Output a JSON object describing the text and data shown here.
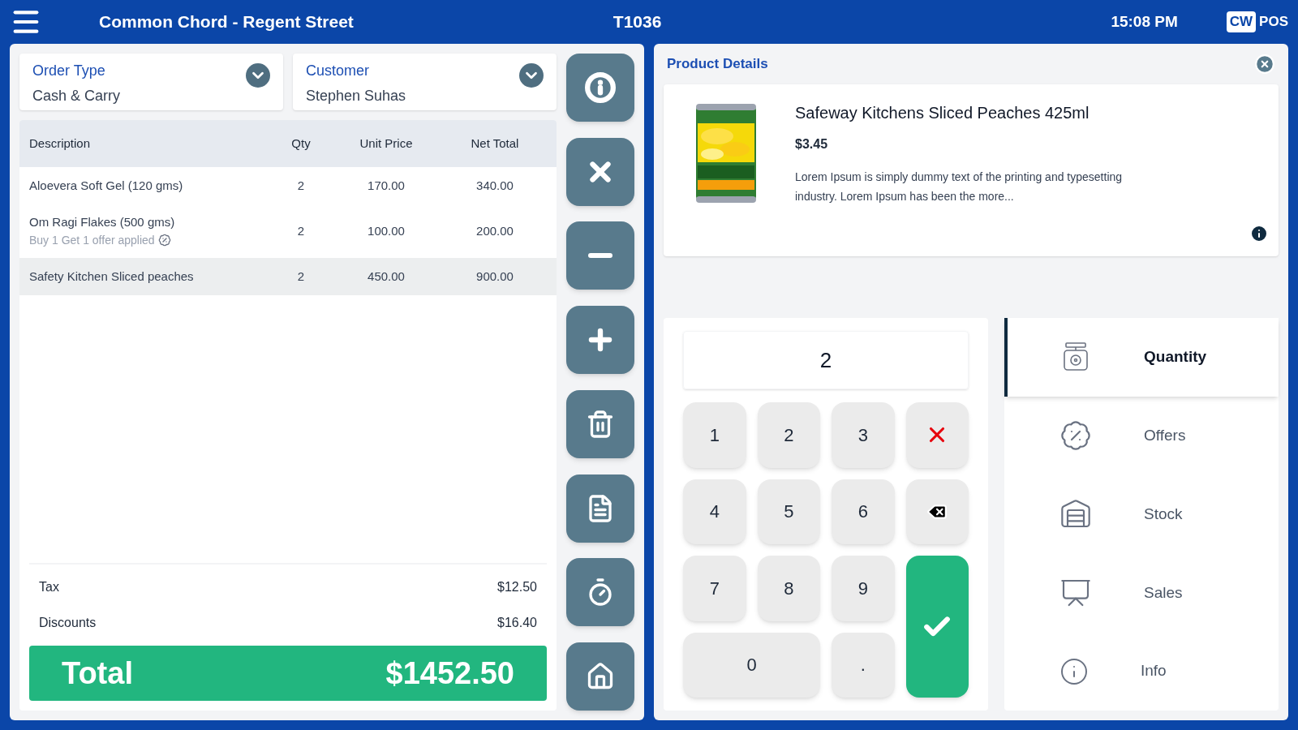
{
  "header": {
    "title": "Common Chord - Regent Street",
    "terminal": "T1036",
    "time": "15:08 PM",
    "logo": {
      "mark": "CW",
      "text": "POS"
    }
  },
  "order_type": {
    "label": "Order Type",
    "value": "Cash & Carry"
  },
  "customer": {
    "label": "Customer",
    "value": "Stephen Suhas"
  },
  "table": {
    "columns": [
      "Description",
      "Qty",
      "Unit Price",
      "Net Total"
    ],
    "rows": [
      {
        "description": "Aloevera Soft Gel (120 gms)",
        "qty": "2",
        "unit_price": "170.00",
        "net_total": "340.00",
        "selected": false
      },
      {
        "description": "Om Ragi Flakes (500 gms)",
        "note": "Buy 1 Get 1 offer applied",
        "qty": "2",
        "unit_price": "100.00",
        "net_total": "200.00",
        "selected": false
      },
      {
        "description": "Safety Kitchen Sliced peaches",
        "qty": "2",
        "unit_price": "450.00",
        "net_total": "900.00",
        "selected": true
      }
    ]
  },
  "summary": [
    {
      "label": "Tax",
      "value": "$12.50"
    },
    {
      "label": "Discounts",
      "value": "$16.40"
    }
  ],
  "total": {
    "label": "Total",
    "value": "$1452.50"
  },
  "actions": [
    {
      "kind": "info"
    },
    {
      "kind": "cancel"
    },
    {
      "kind": "minus"
    },
    {
      "kind": "plus"
    },
    {
      "kind": "delete"
    },
    {
      "kind": "note"
    },
    {
      "kind": "timer"
    },
    {
      "kind": "home"
    }
  ],
  "product": {
    "heading": "Product Details",
    "name": "Safeway Kitchens Sliced Peaches 425ml",
    "price": "$3.45",
    "description": "Lorem Ipsum is simply dummy text of the printing and typesetting industry. Lorem Ipsum has been the more..."
  },
  "keypad": {
    "display": "2",
    "keys": [
      {
        "kind": "digit",
        "label": "1"
      },
      {
        "kind": "digit",
        "label": "2"
      },
      {
        "kind": "digit",
        "label": "3"
      },
      {
        "kind": "clear"
      },
      {
        "kind": "digit",
        "label": "4"
      },
      {
        "kind": "digit",
        "label": "5"
      },
      {
        "kind": "digit",
        "label": "6"
      },
      {
        "kind": "backspace"
      },
      {
        "kind": "digit",
        "label": "7"
      },
      {
        "kind": "digit",
        "label": "8"
      },
      {
        "kind": "digit",
        "label": "9"
      },
      {
        "kind": "enter"
      },
      {
        "kind": "zero",
        "label": "0"
      },
      {
        "kind": "digit",
        "label": "."
      }
    ]
  },
  "menu": [
    {
      "kind": "quantity",
      "label": "Quantity",
      "selected": true
    },
    {
      "kind": "offers",
      "label": "Offers",
      "selected": false
    },
    {
      "kind": "stock",
      "label": "Stock",
      "selected": false
    },
    {
      "kind": "sales",
      "label": "Sales",
      "selected": false
    },
    {
      "kind": "info",
      "label": "Info",
      "selected": false
    }
  ]
}
